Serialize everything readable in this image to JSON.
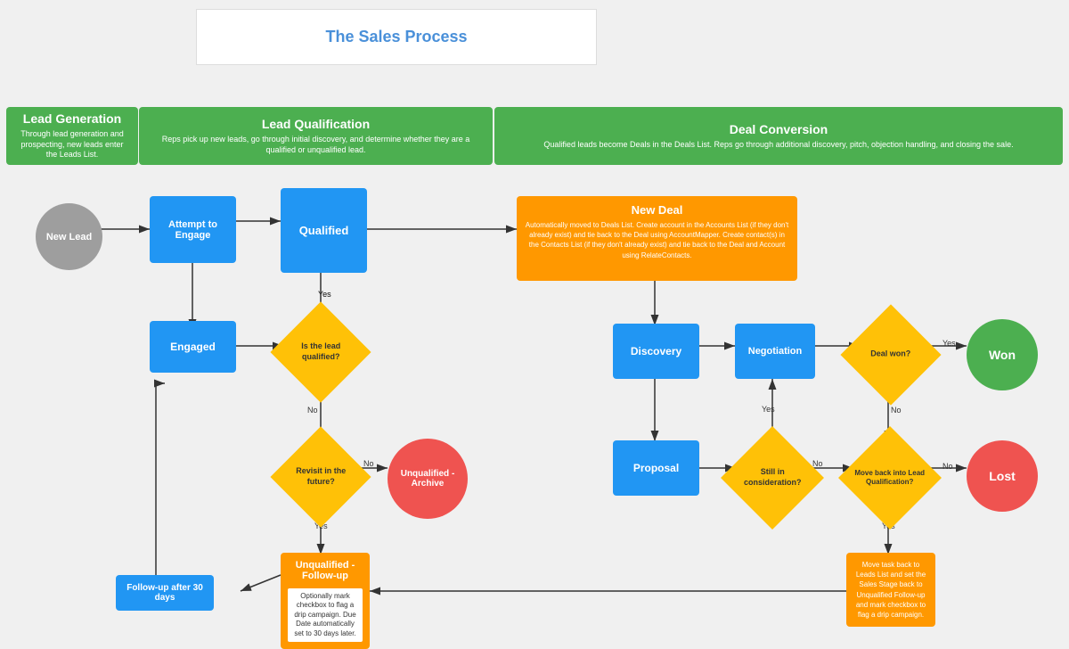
{
  "title": "The Sales Process",
  "phases": [
    {
      "id": "lead-gen",
      "label": "Lead Generation",
      "description": "Through lead generation and prospecting, new leads enter the Leads List."
    },
    {
      "id": "lead-qual",
      "label": "Lead Qualification",
      "description": "Reps pick up new leads, go through initial discovery, and determine whether they are a qualified or unqualified lead."
    },
    {
      "id": "deal-conv",
      "label": "Deal Conversion",
      "description": "Qualified leads become Deals in the Deals List. Reps go through additional discovery, pitch, objection handling, and closing the sale."
    }
  ],
  "nodes": {
    "new_lead": "New Lead",
    "attempt_engage": "Attempt to Engage",
    "qualified": "Qualified",
    "engaged": "Engaged",
    "is_qualified": "Is the lead qualified?",
    "revisit": "Revisit in the future?",
    "unqualified_archive": "Unqualified - Archive",
    "unqualified_followup": "Unqualified - Follow-up",
    "followup_30": "Follow-up after 30 days",
    "new_deal": "New Deal",
    "discovery": "Discovery",
    "negotiation": "Negotiation",
    "proposal": "Proposal",
    "deal_won": "Deal won?",
    "won": "Won",
    "still_considering": "Still in consideration?",
    "move_back": "Move back into Lead Qualification?",
    "lost": "Lost",
    "move_back_action": "Move task back to Leads List and set the Sales Stage back to Unqualified Follow-up and mark checkbox to flag a drip campaign."
  },
  "new_deal_desc": "Automatically moved to Deals List. Create account in the Accounts List (if they don't already exist) and tie back to the Deal using AccountMapper. Create contact(s) in the Contacts List (if they don't already exist) and tie back to the Deal and Account using RelateContacts.",
  "unq_followup_desc": "Optionally mark checkbox to flag a drip campaign. Due Date automatically set to 30 days later.",
  "yes": "Yes",
  "no": "No",
  "colors": {
    "green": "#4caf50",
    "blue": "#2196f3",
    "yellow": "#ffc107",
    "orange": "#ff9800",
    "gray": "#9e9e9e",
    "red": "#ef5350"
  }
}
